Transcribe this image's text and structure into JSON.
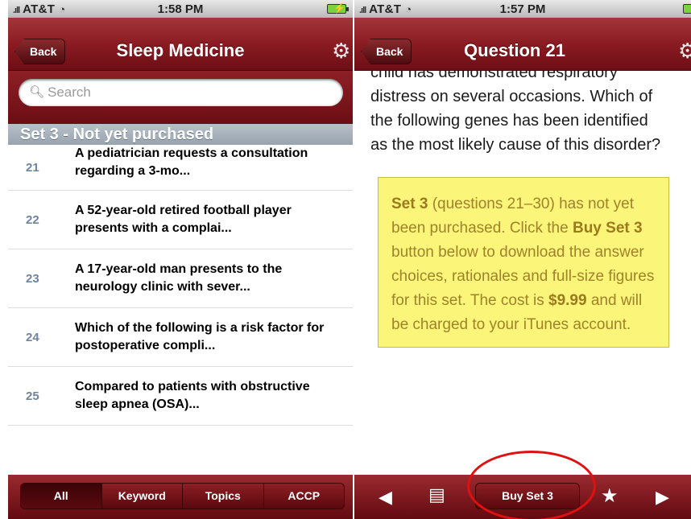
{
  "left": {
    "status": {
      "carrier": "AT&T",
      "time": "1:58 PM"
    },
    "nav": {
      "back_label": "Back",
      "title": "Sleep Medicine"
    },
    "search": {
      "placeholder": "Search"
    },
    "section_header": "Set 3 - Not yet purchased",
    "rows": [
      {
        "num": "21",
        "text": "A pediatrician requests a consultation regarding a 3-mo..."
      },
      {
        "num": "22",
        "text": "A 52-year-old retired football player presents with a complai..."
      },
      {
        "num": "23",
        "text": "A 17-year-old man presents to the neurology clinic with sever..."
      },
      {
        "num": "24",
        "text": "Which of the following is a risk factor for postoperative compli..."
      },
      {
        "num": "25",
        "text": "Compared to patients with obstructive sleep apnea (OSA)..."
      }
    ],
    "tabs": [
      "All",
      "Keyword",
      "Topics",
      "ACCP"
    ],
    "active_tab": "All"
  },
  "right": {
    "status": {
      "carrier": "AT&T",
      "time": "1:57 PM"
    },
    "nav": {
      "back_label": "Back",
      "title": "Question 21"
    },
    "question_text": "child has demonstrated respiratory distress on several occasions. Which of the following genes has been identified as the most likely cause of this disorder?",
    "notice": {
      "set_label": "Set 3",
      "part1": " (questions 21–30) has not yet been purchased. Click the ",
      "buy_label": "Buy Set 3",
      "part2": " button below to download the answer choices, rationales and full-size figures for this set. The cost is ",
      "price": "$9.99",
      "part3": " and will be charged to your iTunes account."
    },
    "toolbar": {
      "buy_button": "Buy Set 3"
    }
  },
  "colors": {
    "nav_red": "#8a1b22",
    "notice_yellow": "#fbf57a",
    "highlight": "#e01010"
  },
  "icons": [
    "search-icon",
    "gear-icon",
    "prev-arrow-icon",
    "notes-icon",
    "star-icon",
    "next-arrow-icon",
    "wifi-icon",
    "battery-icon"
  ]
}
